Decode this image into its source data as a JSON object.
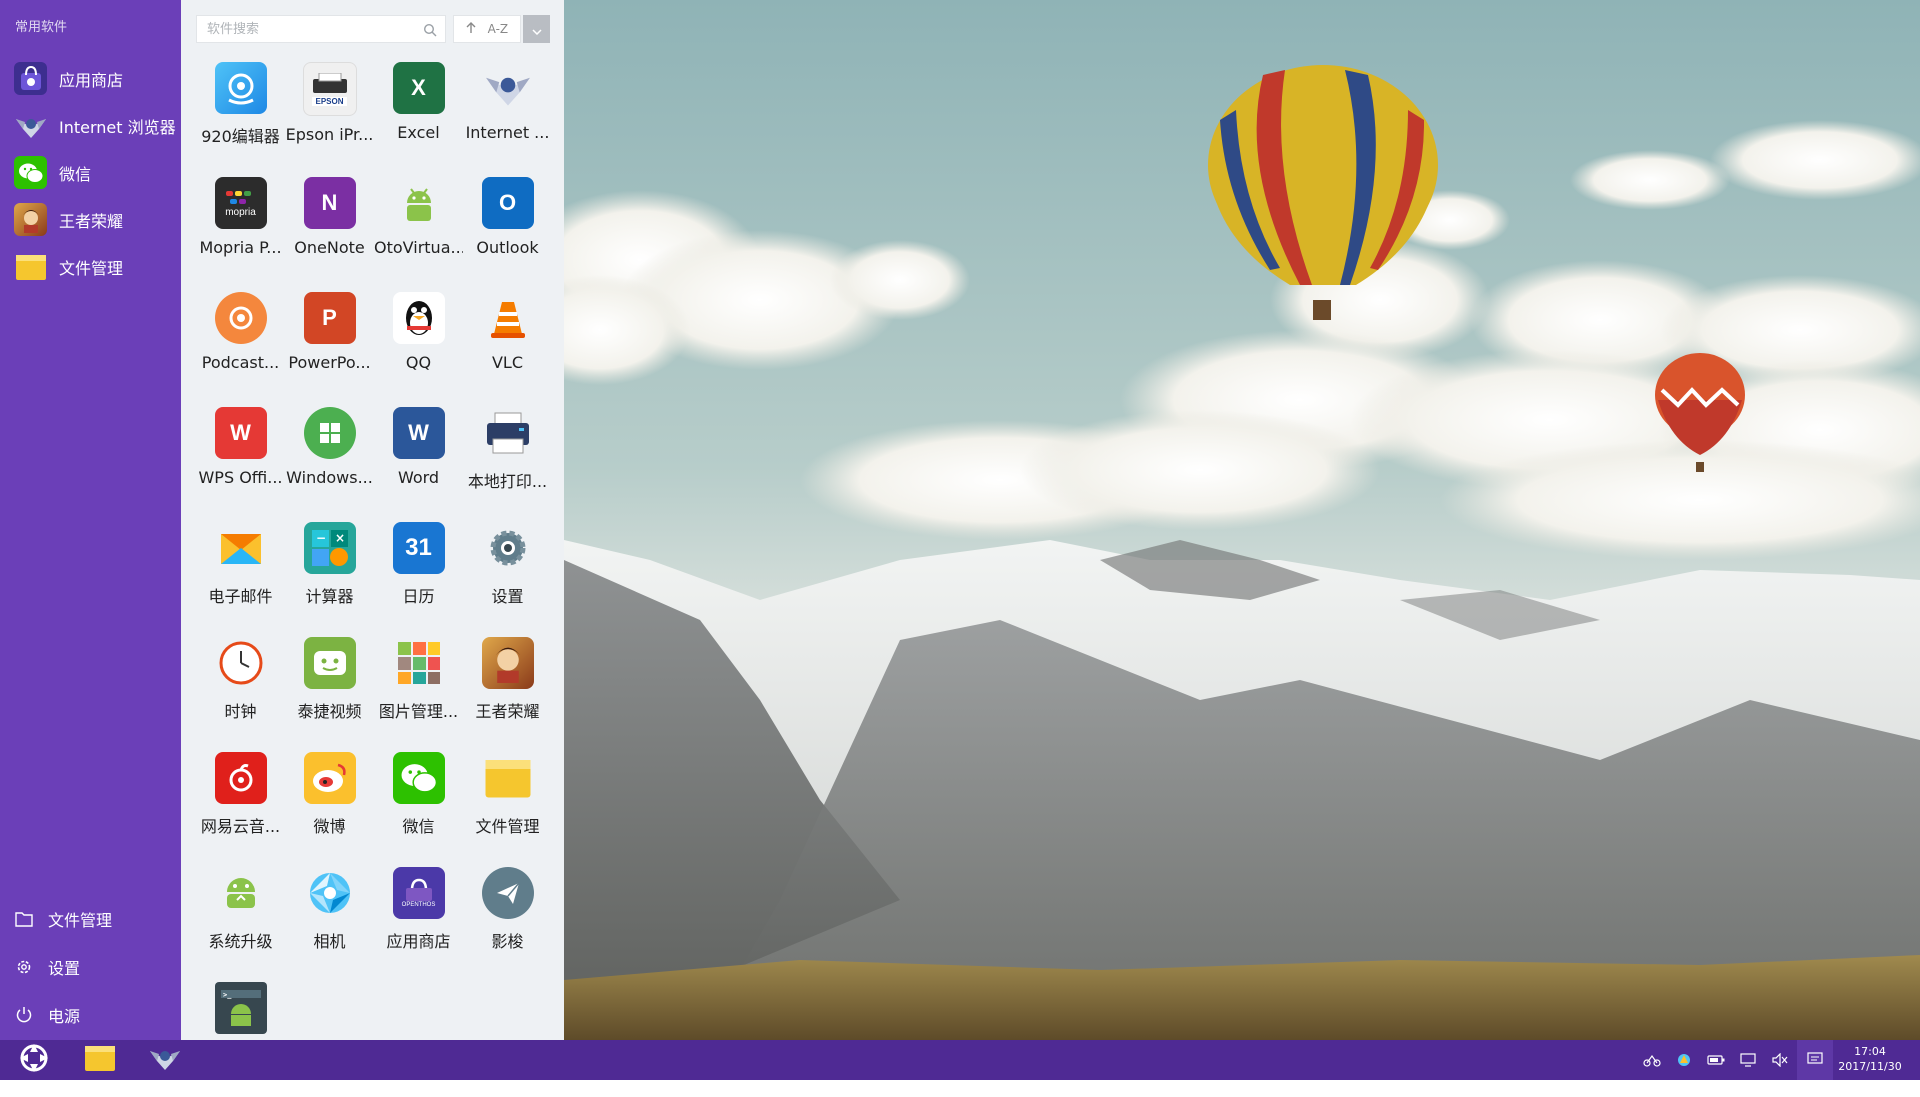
{
  "sidebar": {
    "section_title": "常用软件",
    "favorites": [
      {
        "label": "应用商店",
        "icon": "app-store-icon"
      },
      {
        "label": "Internet 浏览器",
        "icon": "browser-icon"
      },
      {
        "label": "微信",
        "icon": "wechat-icon"
      },
      {
        "label": "王者荣耀",
        "icon": "game-icon"
      },
      {
        "label": "文件管理",
        "icon": "folder-icon"
      }
    ],
    "bottom": [
      {
        "label": "文件管理",
        "icon": "folder-outline-icon"
      },
      {
        "label": "设置",
        "icon": "gear-icon"
      },
      {
        "label": "电源",
        "icon": "power-icon"
      }
    ]
  },
  "drawer": {
    "search_placeholder": "软件搜索",
    "sort_label": "A-Z",
    "apps": [
      {
        "label": "920编辑器"
      },
      {
        "label": "Epson iPr..."
      },
      {
        "label": "Excel"
      },
      {
        "label": "Internet ..."
      },
      {
        "label": "Mopria P..."
      },
      {
        "label": "OneNote"
      },
      {
        "label": "OtoVirtua..."
      },
      {
        "label": "Outlook"
      },
      {
        "label": "Podcast..."
      },
      {
        "label": "PowerPo..."
      },
      {
        "label": "QQ"
      },
      {
        "label": "VLC"
      },
      {
        "label": "WPS Offi..."
      },
      {
        "label": "Windows..."
      },
      {
        "label": "Word"
      },
      {
        "label": "本地打印..."
      },
      {
        "label": "电子邮件"
      },
      {
        "label": "计算器"
      },
      {
        "label": "日历"
      },
      {
        "label": "设置"
      },
      {
        "label": "时钟"
      },
      {
        "label": "泰捷视频"
      },
      {
        "label": "图片管理..."
      },
      {
        "label": "王者荣耀"
      },
      {
        "label": "网易云音..."
      },
      {
        "label": "微博"
      },
      {
        "label": "微信"
      },
      {
        "label": "文件管理"
      },
      {
        "label": "系统升级"
      },
      {
        "label": "相机"
      },
      {
        "label": "应用商店"
      },
      {
        "label": "影梭"
      },
      {
        "label": ""
      }
    ],
    "icon_texts": {
      "epson": "EPSON",
      "excel": "X",
      "onenote": "N",
      "outlook": "O",
      "powerpoint": "P",
      "wps": "W",
      "word": "W",
      "calendar": "31",
      "mopria": "mopria",
      "store": "OPENTHOS"
    }
  },
  "taskbar": {
    "time": "17:04",
    "date": "2017/11/30"
  },
  "colors": {
    "sidebar": "#6b3fb8",
    "taskbar": "#4f2a94",
    "drawer": "#eef1f4"
  }
}
